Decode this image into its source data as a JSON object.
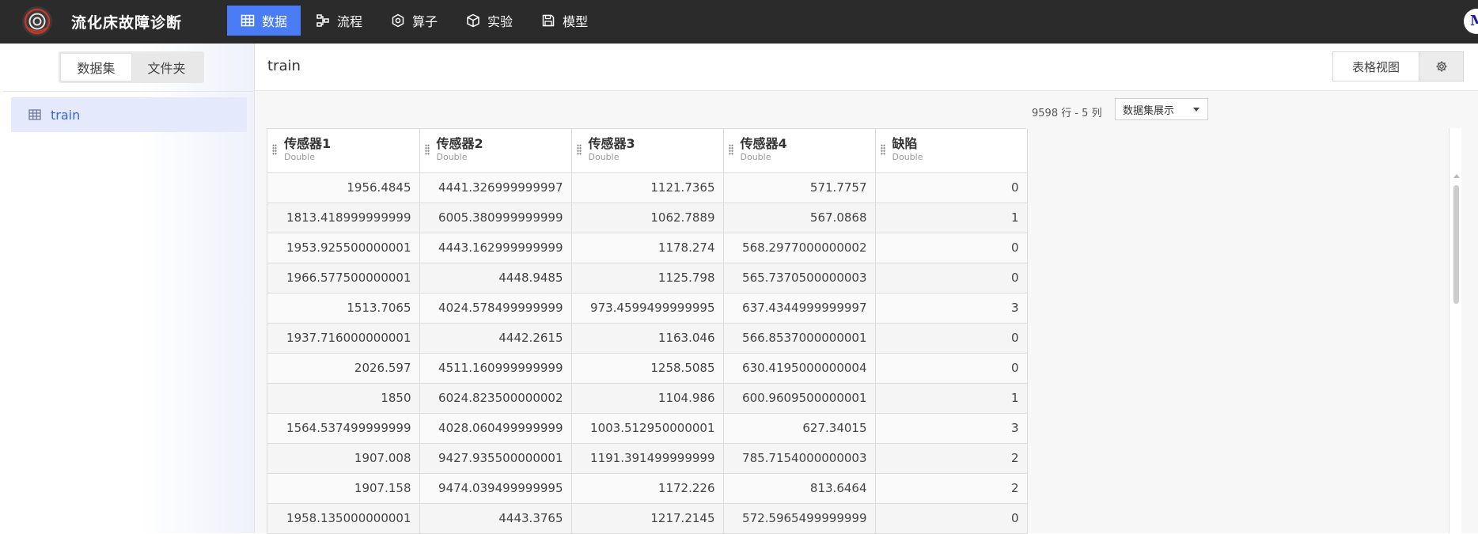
{
  "app": {
    "title": "流化床故障诊断",
    "avatar_letter": "M"
  },
  "nav": [
    {
      "label": "数据",
      "icon": "table-icon",
      "active": true
    },
    {
      "label": "流程",
      "icon": "flow-icon",
      "active": false
    },
    {
      "label": "算子",
      "icon": "operator-icon",
      "active": false
    },
    {
      "label": "实验",
      "icon": "cube-icon",
      "active": false
    },
    {
      "label": "模型",
      "icon": "save-icon",
      "active": false
    }
  ],
  "sidebar": {
    "tabs": [
      {
        "label": "数据集",
        "active": true
      },
      {
        "label": "文件夹",
        "active": false
      }
    ],
    "items": [
      {
        "label": "train",
        "icon": "table-icon",
        "selected": true
      }
    ]
  },
  "main": {
    "title": "train",
    "view_label": "表格视图",
    "row_count": "9598 行 - 5 列",
    "display_select": "数据集展示"
  },
  "table": {
    "columns": [
      {
        "name": "传感器1",
        "type": "Double"
      },
      {
        "name": "传感器2",
        "type": "Double"
      },
      {
        "name": "传感器3",
        "type": "Double"
      },
      {
        "name": "传感器4",
        "type": "Double"
      },
      {
        "name": "缺陷",
        "type": "Double"
      }
    ],
    "rows": [
      [
        "1956.4845",
        "4441.326999999997",
        "1121.7365",
        "571.7757",
        "0"
      ],
      [
        "1813.418999999999",
        "6005.380999999999",
        "1062.7889",
        "567.0868",
        "1"
      ],
      [
        "1953.925500000001",
        "4443.162999999999",
        "1178.274",
        "568.2977000000002",
        "0"
      ],
      [
        "1966.577500000001",
        "4448.9485",
        "1125.798",
        "565.7370500000003",
        "0"
      ],
      [
        "1513.7065",
        "4024.578499999999",
        "973.4599499999995",
        "637.4344999999997",
        "3"
      ],
      [
        "1937.716000000001",
        "4442.2615",
        "1163.046",
        "566.8537000000001",
        "0"
      ],
      [
        "2026.597",
        "4511.160999999999",
        "1258.5085",
        "630.4195000000004",
        "0"
      ],
      [
        "1850",
        "6024.823500000002",
        "1104.986",
        "600.9609500000001",
        "1"
      ],
      [
        "1564.537499999999",
        "4028.060499999999",
        "1003.512950000001",
        "627.34015",
        "3"
      ],
      [
        "1907.008",
        "9427.935500000001",
        "1191.391499999999",
        "785.7154000000003",
        "2"
      ],
      [
        "1907.158",
        "9474.039499999995",
        "1172.226",
        "813.6464",
        "2"
      ],
      [
        "1958.135000000001",
        "4443.3765",
        "1217.2145",
        "572.5965499999999",
        "0"
      ]
    ]
  },
  "colors": {
    "accent": "#4a7cf5",
    "topbar": "#2b2b2b",
    "selected_bg": "#e4e9fb",
    "selected_text": "#3b63e0"
  }
}
